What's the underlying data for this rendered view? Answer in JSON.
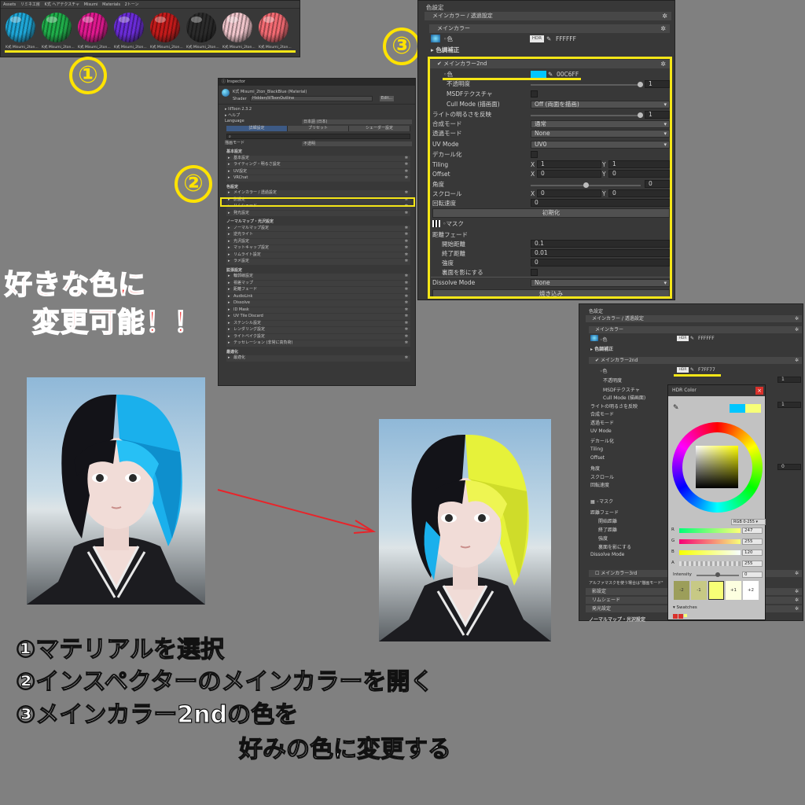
{
  "project": {
    "breadcrumbs": [
      "Assets",
      "リミネ工房",
      "K式 ヘアテクスチャ",
      "Misumi",
      "Materials",
      "2トーン"
    ],
    "materials": [
      {
        "label": "K式 Misumi_2ton...",
        "color": "#1ea7d8"
      },
      {
        "label": "K式 Misumi_2ton...",
        "color": "#1fae4a"
      },
      {
        "label": "K式 Misumi_2ton...",
        "color": "#e0188f"
      },
      {
        "label": "K式 Misumi_2ton...",
        "color": "#6a2bd8"
      },
      {
        "label": "K式 Misumi_2ton...",
        "color": "#c41a1a"
      },
      {
        "label": "K式 Misumi_2ton...",
        "color": "#2b2b2b"
      },
      {
        "label": "K式 Misumi_2ton...",
        "color": "#f1c6cc"
      },
      {
        "label": "K式 Misumi_2ton...",
        "color": "#f36a72"
      }
    ]
  },
  "steps_markers": {
    "one": "①",
    "two": "②",
    "three": "③"
  },
  "inspector": {
    "tab": "Inspector",
    "material_name": "K式 Misumi_2ton_BlackBlue (Material)",
    "shader_label": "Shader",
    "shader_value": "Hidden/lilToonOutline",
    "edit_button": "Edit...",
    "version": "lilToon 2.3.2",
    "help": "ヘルプ",
    "language_label": "Language",
    "language_value": "日本語 (日本)",
    "mode_tabs": [
      "詳細設定",
      "プリセット",
      "シェーダー設定"
    ],
    "render_mode_label": "描画モード",
    "render_mode_value": "不透明",
    "basic_header": "基本設定",
    "basic_items": [
      "基本設定",
      "ライティング・明るさ設定",
      "UV設定",
      "VRChat"
    ],
    "color_header": "色設定",
    "color_items": [
      "メインカラー / 透過設定",
      "影設定",
      "リムシェード",
      "発光設定"
    ],
    "normal_header": "ノーマルマップ・光沢設定",
    "normal_items": [
      "ノーマルマップ設定",
      "逆光ライト",
      "光沢設定",
      "マットキャップ設定",
      "リムライト設定",
      "ラメ設定"
    ],
    "ext_header": "拡張設定",
    "ext_items": [
      "輪郭線設定",
      "視差マップ",
      "距離フェード",
      "AudioLink",
      "Dissolve",
      "ID Mask",
      "UV Tile Discard",
      "ステンシル設定",
      "レンダリング設定",
      "ライトベイク設定",
      "テッセレーション (非常に高負荷)"
    ],
    "opt_header": "最適化",
    "opt_items": [
      "最適化"
    ]
  },
  "main_panel": {
    "title": "色設定",
    "section_bar": "メインカラー / 透過設定",
    "main_color_bar": "メインカラー",
    "color_label": "色",
    "hdr": "HDR",
    "main_hex": "FFFFFF",
    "tone_correction": "色調補正",
    "second_bar": "メインカラー2nd",
    "second_hex": "00C6FF",
    "second_swatch": "#00c6ff",
    "opacity_label": "不透明度",
    "opacity_value": "1",
    "msdf_label": "MSDFテクスチャ",
    "cull_label": "Cull Mode (描画面)",
    "cull_value": "Off (両面を描画)",
    "light_label": "ライトの明るさを反映",
    "light_value": "1",
    "blend_label": "合成モード",
    "blend_value": "通常",
    "alpha_label": "透過モード",
    "alpha_value": "None",
    "uv_label": "UV Mode",
    "uv_value": "UV0",
    "decal_label": "デカール化",
    "tiling_label": "Tiling",
    "tiling_x": "1",
    "tiling_y": "1",
    "offset_label": "Offset",
    "offset_x": "0",
    "offset_y": "0",
    "angle_label": "角度",
    "angle_value": "0",
    "scroll_label": "スクロール",
    "scroll_x": "0",
    "scroll_y": "0",
    "rotation_label": "回転速度",
    "rotation_value": "0",
    "reset_button": "初期化",
    "mask_label": "マスク",
    "fade_header": "距離フェード",
    "fade_start_label": "開始距離",
    "fade_start_value": "0.1",
    "fade_end_label": "終了距離",
    "fade_end_value": "0.01",
    "fade_strength_label": "強度",
    "fade_strength_value": "0",
    "fade_back_label": "裏面を影にする",
    "dissolve_label": "Dissolve Mode",
    "dissolve_value": "None",
    "bake_button": "焼き込み",
    "x": "X",
    "y": "Y"
  },
  "right_panel": {
    "title": "色設定",
    "section_bar": "メインカラー / 透過設定",
    "main_color_bar": "メインカラー",
    "color_label": "色",
    "hdr": "HDR",
    "main_hex": "FFFFFF",
    "tone_correction": "色調補正",
    "second_bar": "メインカラー2nd",
    "second_hex": "F7FF77",
    "second_swatch": "#f7ff77",
    "opacity_label": "不透明度",
    "msdf_label": "MSDFテクスチャ",
    "cull_label": "Cull Mode (描画面)",
    "light_label": "ライトの明るさを反映",
    "blend_label": "合成モード",
    "alpha_label": "透過モード",
    "uv_label": "UV Mode",
    "decal_label": "デカール化",
    "tiling_label": "Tiling",
    "offset_label": "Offset",
    "angle_label": "角度",
    "scroll_label": "スクロール",
    "rotation_label": "回転速度",
    "mask_label": "マスク",
    "fade_header": "距離フェード",
    "fade_start_label": "開始距離",
    "fade_end_label": "終了距離",
    "fade_strength_label": "強度",
    "fade_back_label": "裏面を影にする",
    "dissolve_label": "Dissolve Mode",
    "third_label": "メインカラー3rd",
    "alpha_mask_note": "アルファマスクを使う場合は\"描画モード\"",
    "shadow_label": "影設定",
    "rim_label": "リムシェード",
    "emission_label": "発光設定",
    "normal_label": "ノーマルマップ・光沢設定",
    "value_one": "1",
    "value_zero": "0"
  },
  "hdr_window": {
    "title": "HDR Color",
    "mode": "RGB 0-255",
    "channels": [
      {
        "label": "R",
        "value": "247"
      },
      {
        "label": "G",
        "value": "255"
      },
      {
        "label": "B",
        "value": "120"
      },
      {
        "label": "A",
        "value": "255"
      }
    ],
    "intensity_label": "Intensity",
    "intensity_value": "0",
    "presets": [
      "-2",
      "-1",
      "",
      "+1",
      "+2"
    ],
    "swatches_label": "Swatches",
    "previous_color": "#00c6ff",
    "current_color": "#f7ff77"
  },
  "callout": {
    "line1": "好きな色に",
    "line2": "変更可能！！"
  },
  "instructions": {
    "step1": "①マテリアルを選択",
    "step2": "②インスペクターのメインカラーを開く",
    "step3": "③メインカラー2ndの色を",
    "step3b": "好みの色に変更する"
  },
  "colors": {
    "highlight_yellow": "#f5e617",
    "callout_red": "#f01a1a",
    "before_hair": "#1ab0ec",
    "after_hair": "#e6f23a",
    "arrow_red": "#e8242a"
  }
}
